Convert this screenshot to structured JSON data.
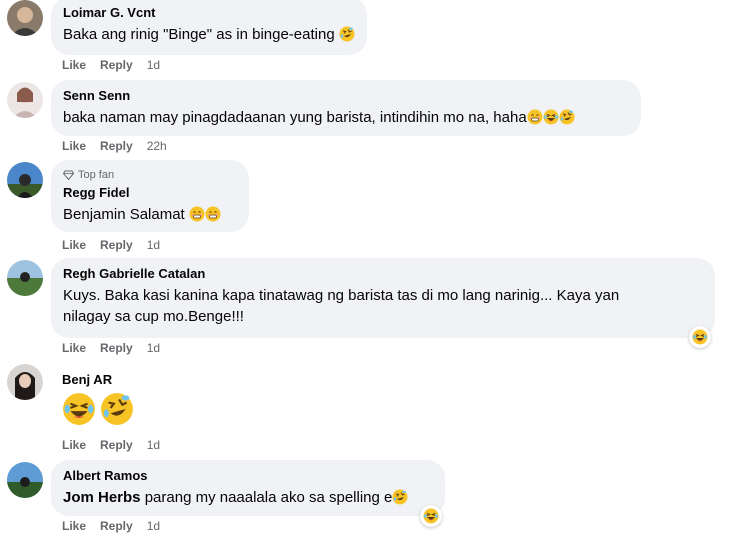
{
  "actions": {
    "like": "Like",
    "reply": "Reply"
  },
  "comments": [
    {
      "author": "Loimar G. Vcnt",
      "text": "Baka ang rinig \"Binge\" as in binge-eating",
      "time": "1d"
    },
    {
      "author": "Senn Senn",
      "text": "baka naman may pinagdadaanan yung barista, intindihin mo na, haha",
      "time": "22h"
    },
    {
      "badge": "Top fan",
      "author": "Regg Fidel",
      "text": "Benjamin Salamat",
      "time": "1d"
    },
    {
      "author": "Regh Gabrielle Catalan",
      "text_line1": "Kuys. Baka kasi kanina kapa tinatawag ng barista tas di mo lang narinig... Kaya yan",
      "text_line2": "nilagay sa cup mo.Benge!!!",
      "time": "1d"
    },
    {
      "author": "Benj AR",
      "time": "1d"
    },
    {
      "author": "Albert Ramos",
      "mention": "Jom Herbs",
      "text": " parang my naaalala ako sa spelling e",
      "time": "1d"
    }
  ],
  "colors": {
    "bubble": "#f0f2f5",
    "meta": "#65676b",
    "emoji": "#f7b500"
  }
}
